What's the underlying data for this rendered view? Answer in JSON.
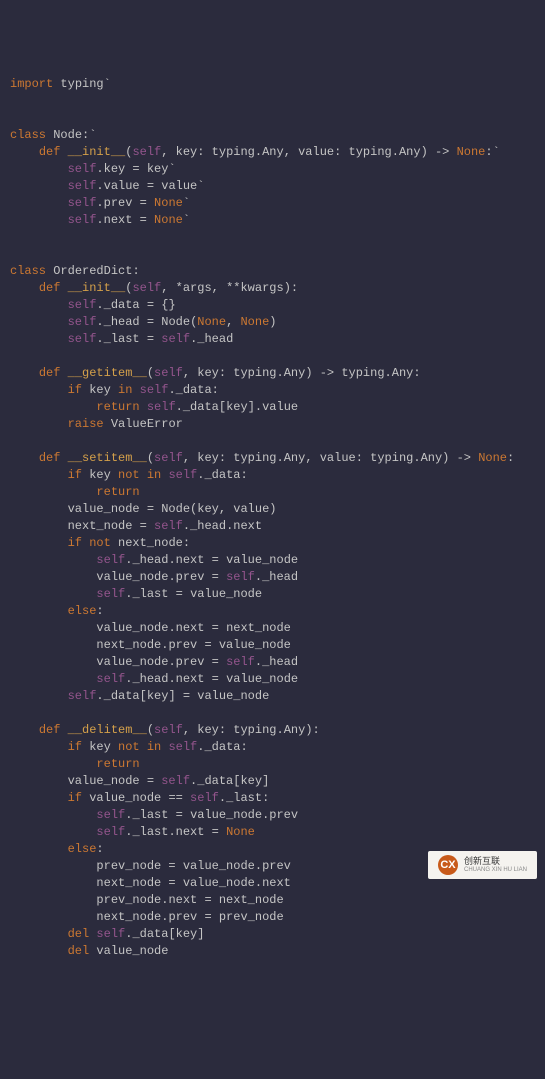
{
  "code": {
    "l1": {
      "import": "import",
      "typing": "typing",
      "tick": "`"
    },
    "l4": {
      "class": "class",
      "Node": "Node",
      "colon": ":",
      "tick": "`"
    },
    "l5": {
      "def": "def",
      "init": "__init__",
      "op": "(",
      "self": "self",
      "c1": ", ",
      "key": "key",
      "col1": ": ",
      "t1": "typing",
      "d1": ".",
      "a1": "Any",
      "c2": ", ",
      "value": "value",
      "col2": ": ",
      "t2": "typing",
      "d2": ".",
      "a2": "Any",
      "cp": ")",
      "arr": " -> ",
      "none": "None",
      "colon": ":",
      "tick": "`"
    },
    "l6": {
      "self": "self",
      "d": ".",
      "key": "key",
      "eq": " = ",
      "key2": "key",
      "tick": "`"
    },
    "l7": {
      "self": "self",
      "d": ".",
      "value": "value",
      "eq": " = ",
      "value2": "value",
      "tick": "`"
    },
    "l8": {
      "self": "self",
      "d": ".",
      "prev": "prev",
      "eq": " = ",
      "none": "None",
      "tick": "`"
    },
    "l9": {
      "self": "self",
      "d": ".",
      "next": "next",
      "eq": " = ",
      "none": "None",
      "tick": "`"
    },
    "l12": {
      "class": "class",
      "OD": "OrderedDict",
      "colon": ":"
    },
    "l13": {
      "def": "def",
      "init": "__init__",
      "op": "(",
      "self": "self",
      "c1": ", *",
      "args": "args",
      "c2": ", **",
      "kwargs": "kwargs",
      "cp": "):"
    },
    "l14": {
      "self": "self",
      "d": ".",
      "data": "_data",
      "eq": " = {}",
      "tick": ""
    },
    "l15": {
      "self": "self",
      "d": ".",
      "head": "_head",
      "eq": " = ",
      "Node": "Node",
      "op": "(",
      "n1": "None",
      "c": ", ",
      "n2": "None",
      "cp": ")"
    },
    "l16": {
      "self": "self",
      "d": ".",
      "last": "_last",
      "eq": " = ",
      "self2": "self",
      "d2": ".",
      "head": "_head"
    },
    "l18": {
      "def": "def",
      "gi": "__getitem__",
      "op": "(",
      "self": "self",
      "c1": ", ",
      "key": "key",
      "col": ": ",
      "t": "typing",
      "d": ".",
      "a": "Any",
      "cp": ")",
      "arr": " -> ",
      "t2": "typing",
      "d2": ".",
      "a2": "Any",
      "colon": ":"
    },
    "l19": {
      "if": "if",
      "key": " key ",
      "in": "in",
      "sp": " ",
      "self": "self",
      "d": ".",
      "data": "_data",
      "colon": ":"
    },
    "l20": {
      "return": "return",
      "sp": " ",
      "self": "self",
      "d": ".",
      "data": "_data",
      "ob": "[",
      "key": "key",
      "cb": "]",
      "d2": ".",
      "value": "value"
    },
    "l21": {
      "raise": "raise",
      "sp": " ",
      "ve": "ValueError"
    },
    "l23": {
      "def": "def",
      "si": "__setitem__",
      "op": "(",
      "self": "self",
      "c1": ", ",
      "key": "key",
      "col": ": ",
      "t": "typing",
      "d": ".",
      "a": "Any",
      "c2": ", ",
      "value": "value",
      "col2": ": ",
      "t2": "typing",
      "d2": ".",
      "a2": "Any",
      "cp": ")",
      "arr": " -> ",
      "none": "None",
      "colon": ":"
    },
    "l24": {
      "if": "if",
      "key": " key ",
      "not": "not in",
      "sp": " ",
      "self": "self",
      "d": ".",
      "data": "_data",
      "colon": ":"
    },
    "l25": {
      "return": "return"
    },
    "l26": {
      "vn": "value_node",
      "eq": " = ",
      "Node": "Node",
      "op": "(",
      "key": "key",
      "c": ", ",
      "value": "value",
      "cp": ")"
    },
    "l27": {
      "nn": "next_node",
      "eq": " = ",
      "self": "self",
      "d": ".",
      "head": "_head",
      "d2": ".",
      "next": "next"
    },
    "l28": {
      "if": "if",
      "not": " not ",
      "nn": "next_node",
      "colon": ":"
    },
    "l29": {
      "self": "self",
      "d": ".",
      "head": "_head",
      "d2": ".",
      "next": "next",
      "eq": " = ",
      "vn": "value_node"
    },
    "l30": {
      "vn": "value_node",
      "d": ".",
      "prev": "prev",
      "eq": " = ",
      "self": "self",
      "d2": ".",
      "head": "_head"
    },
    "l31": {
      "self": "self",
      "d": ".",
      "last": "_last",
      "eq": " = ",
      "vn": "value_node"
    },
    "l32": {
      "else": "else",
      "colon": ":"
    },
    "l33": {
      "vn": "value_node",
      "d": ".",
      "next": "next",
      "eq": " = ",
      "nn": "next_node"
    },
    "l34": {
      "nn": "next_node",
      "d": ".",
      "prev": "prev",
      "eq": " = ",
      "vn": "value_node"
    },
    "l35": {
      "vn": "value_node",
      "d": ".",
      "prev": "prev",
      "eq": " = ",
      "self": "self",
      "d2": ".",
      "head": "_head"
    },
    "l36": {
      "self": "self",
      "d": ".",
      "head": "_head",
      "d2": ".",
      "next": "next",
      "eq": " = ",
      "vn": "value_node"
    },
    "l37": {
      "self": "self",
      "d": ".",
      "data": "_data",
      "ob": "[",
      "key": "key",
      "cb": "]",
      "eq": " = ",
      "vn": "value_node"
    },
    "l39": {
      "def": "def",
      "di": "__delitem__",
      "op": "(",
      "self": "self",
      "c1": ", ",
      "key": "key",
      "col": ": ",
      "t": "typing",
      "d": ".",
      "a": "Any",
      "cp": "):"
    },
    "l40": {
      "if": "if",
      "key": " key ",
      "not": "not in",
      "sp": " ",
      "self": "self",
      "d": ".",
      "data": "_data",
      "colon": ":"
    },
    "l41": {
      "return": "return"
    },
    "l42": {
      "vn": "value_node",
      "eq": " = ",
      "self": "self",
      "d": ".",
      "data": "_data",
      "ob": "[",
      "key": "key",
      "cb": "]"
    },
    "l43": {
      "if": "if",
      "vn": " value_node ",
      "eq": "==",
      "sp": " ",
      "self": "self",
      "d": ".",
      "last": "_last",
      "colon": ":"
    },
    "l44": {
      "self": "self",
      "d": ".",
      "last": "_last",
      "eq": " = ",
      "vn": "value_node",
      "d2": ".",
      "prev": "prev"
    },
    "l45": {
      "self": "self",
      "d": ".",
      "last": "_last",
      "d2": ".",
      "next": "next",
      "eq": " = ",
      "none": "None"
    },
    "l46": {
      "else": "else",
      "colon": ":"
    },
    "l47": {
      "pn": "prev_node",
      "eq": " = ",
      "vn": "value_node",
      "d": ".",
      "prev": "prev"
    },
    "l48": {
      "nn": "next_node",
      "eq": " = ",
      "vn": "value_node",
      "d": ".",
      "next": "next"
    },
    "l49": {
      "pn": "prev_node",
      "d": ".",
      "next": "next",
      "eq": " = ",
      "nn": "next_node"
    },
    "l50": {
      "nn": "next_node",
      "d": ".",
      "prev": "prev",
      "eq": " = ",
      "pn": "prev_node"
    },
    "l51": {
      "del": "del",
      "sp": " ",
      "self": "self",
      "d": ".",
      "data": "_data",
      "ob": "[",
      "key": "key",
      "cb": "]"
    },
    "l52": {
      "del": "del",
      "sp": " ",
      "vn": "value_node"
    }
  },
  "watermark": {
    "brand": "创新互联",
    "sub": "CHUANG XIN HU LIAN",
    "icon": "CX"
  }
}
